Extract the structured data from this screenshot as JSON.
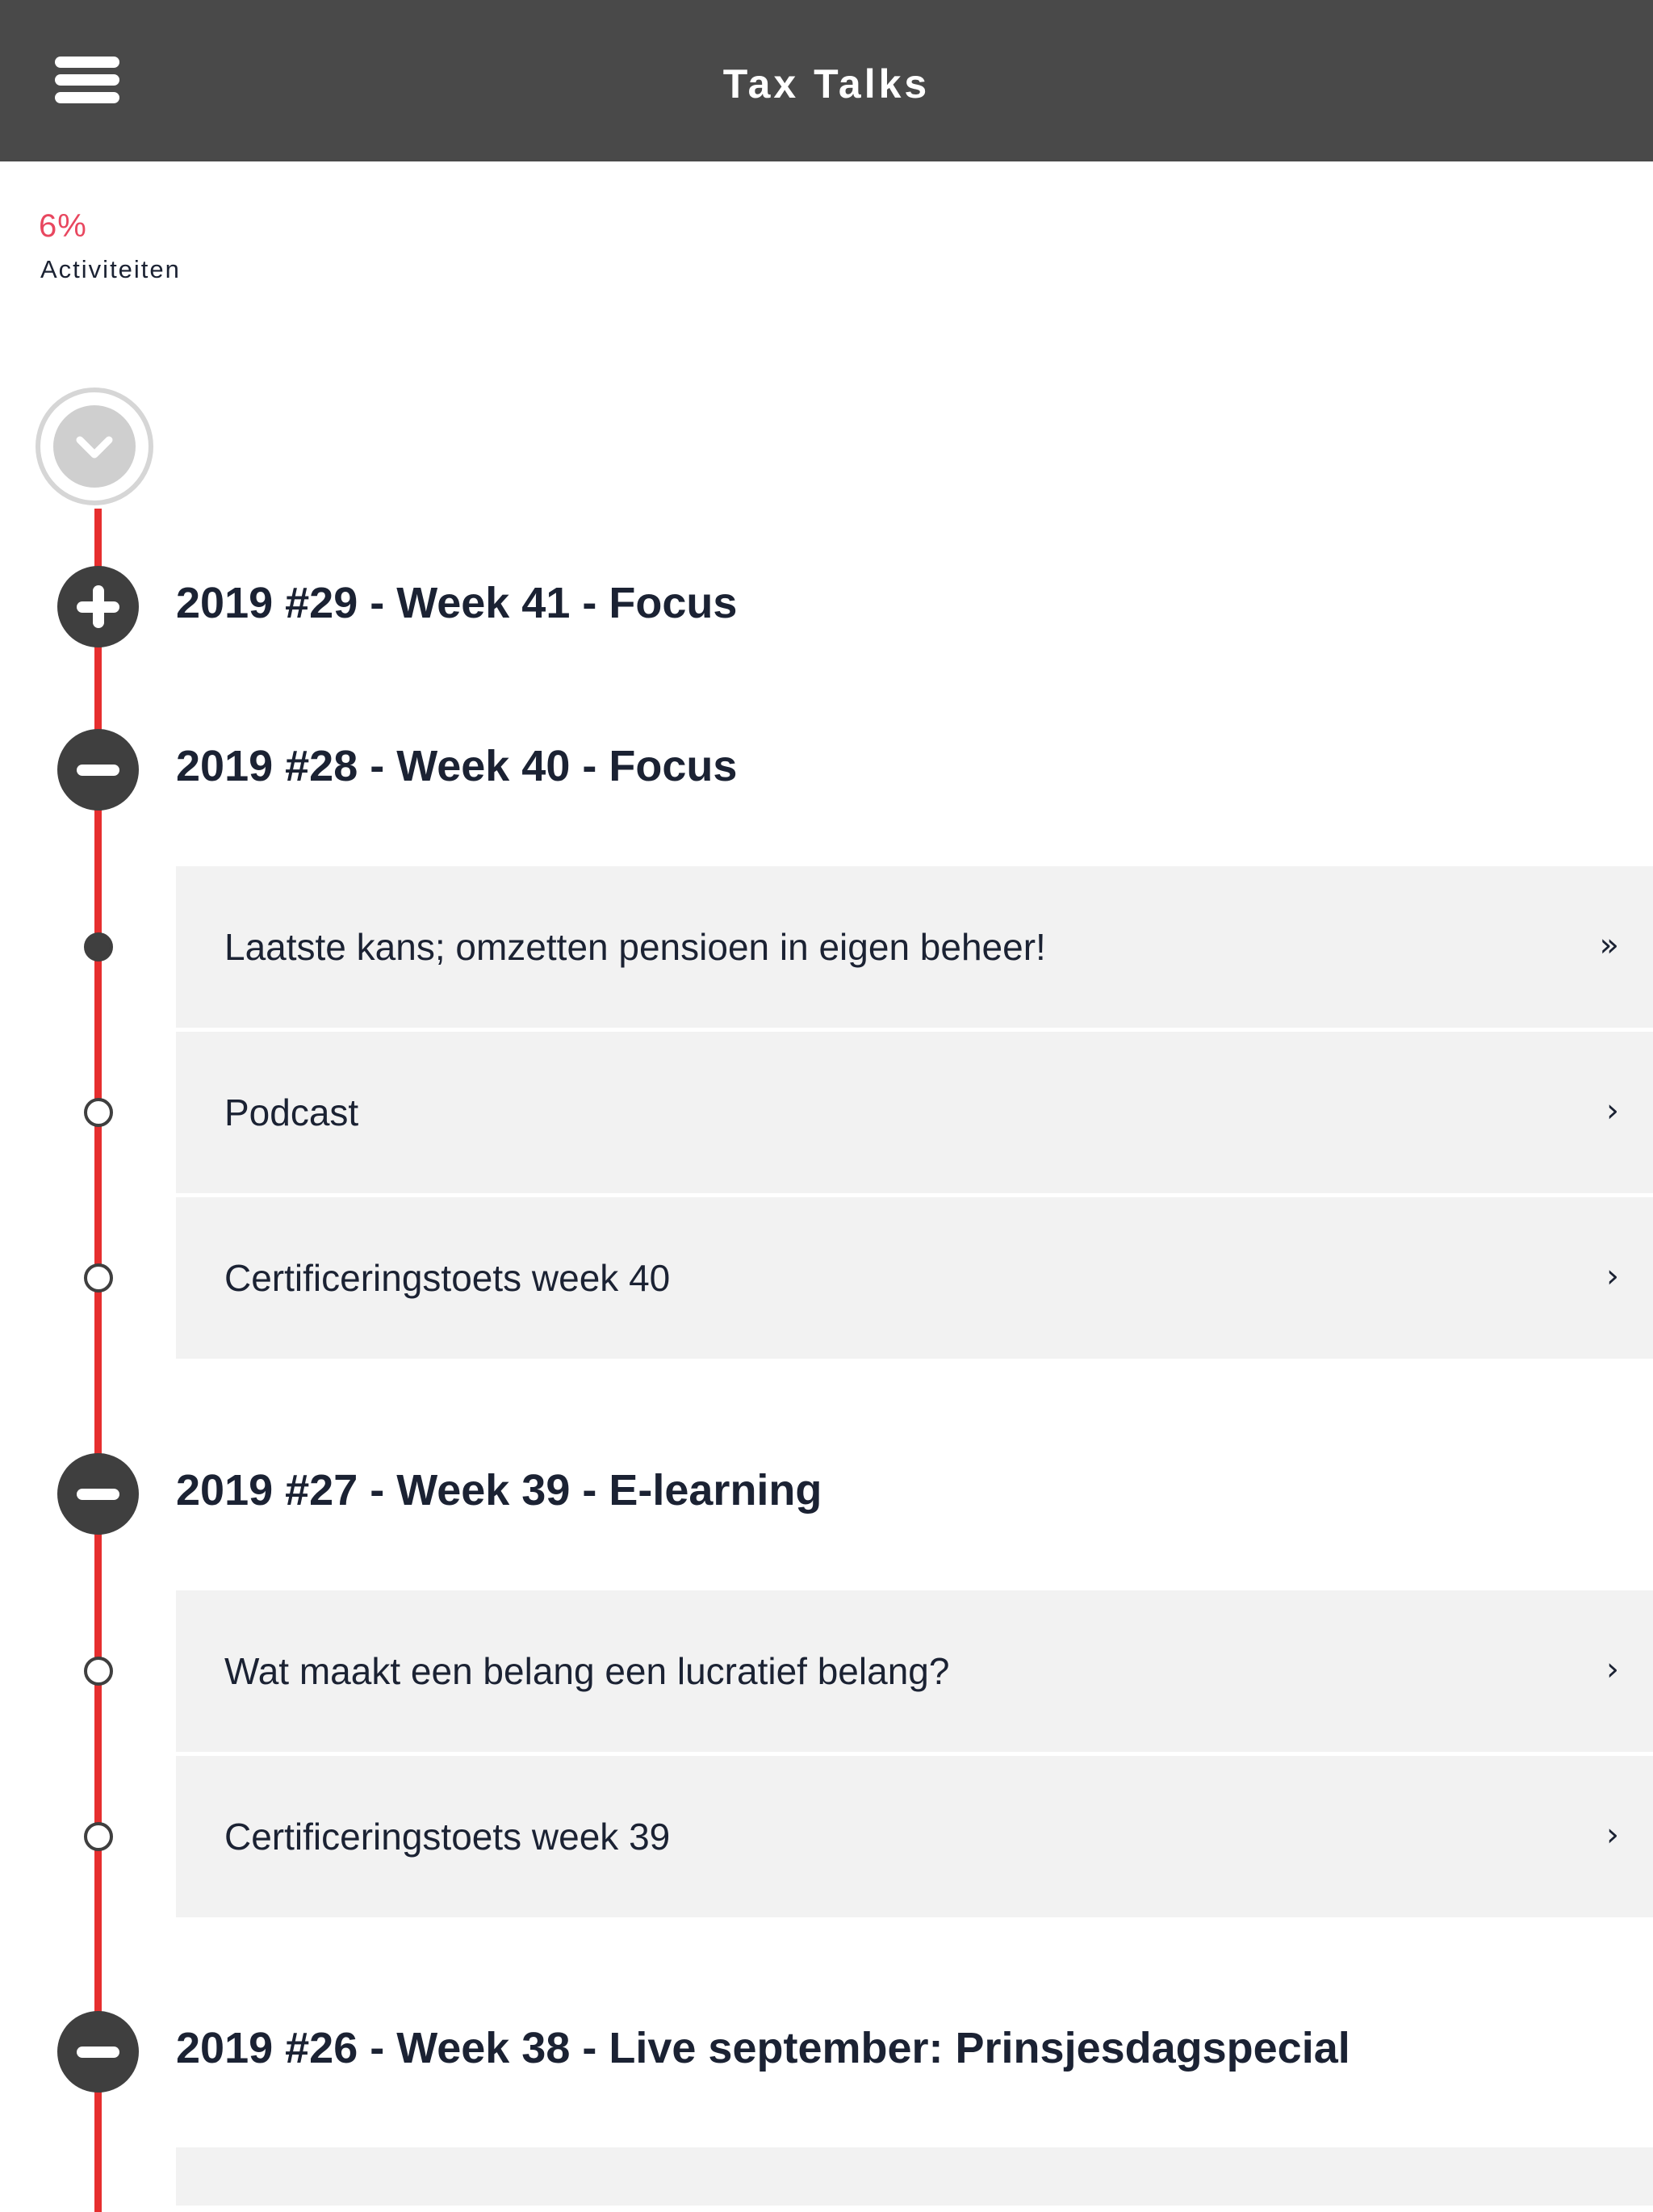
{
  "header": {
    "title": "Tax Talks"
  },
  "progress": {
    "percent": "6%",
    "label": "Activiteiten"
  },
  "colors": {
    "accent": "#e8475f",
    "timeline": "#e62e2e",
    "header_bg": "#494949",
    "card_bg": "#f2f2f2"
  },
  "sections": [
    {
      "title": "2019 #29 - Week 41 - Focus",
      "state": "collapsed",
      "icon": "plus-icon",
      "items": []
    },
    {
      "title": "2019 #28 - Week 40 - Focus",
      "state": "expanded",
      "icon": "minus-icon",
      "items": [
        {
          "label": "Laatste kans; omzetten pensioen in eigen beheer!",
          "arrow": "»",
          "status": "done"
        },
        {
          "label": "Podcast",
          "arrow": "›",
          "status": "open"
        },
        {
          "label": "Certificeringstoets week 40",
          "arrow": "›",
          "status": "open"
        }
      ]
    },
    {
      "title": "2019 #27 - Week 39 - E-learning",
      "state": "expanded",
      "icon": "minus-icon",
      "items": [
        {
          "label": "Wat maakt een belang een lucratief belang?",
          "arrow": "›",
          "status": "open"
        },
        {
          "label": "Certificeringstoets week 39",
          "arrow": "›",
          "status": "open"
        }
      ]
    },
    {
      "title": "2019 #26 - Week 38 - Live september: Prinsjesdagspecial",
      "state": "expanded",
      "icon": "minus-icon",
      "items": []
    }
  ]
}
